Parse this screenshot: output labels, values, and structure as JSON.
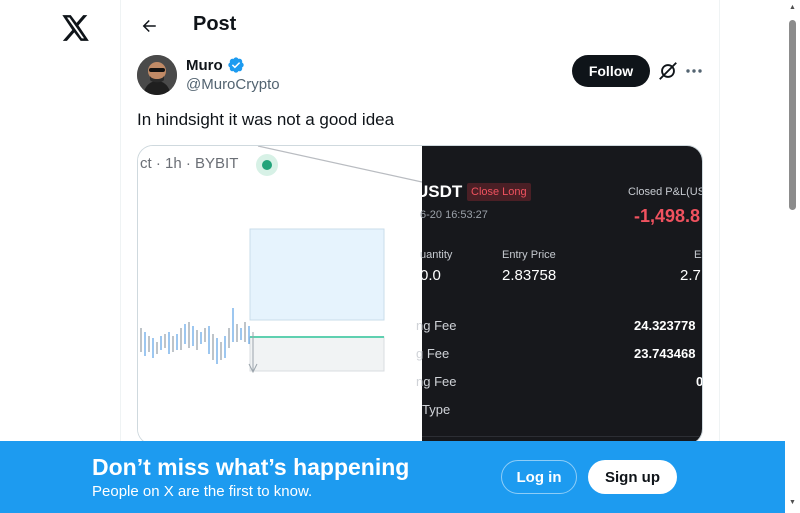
{
  "header": {
    "title": "Post"
  },
  "post": {
    "author_name": "Muro",
    "author_handle": "@MuroCrypto",
    "follow_label": "Follow",
    "text": "In hindsight it was not a good idea"
  },
  "media": {
    "chart_header": "ct · 1h · BYBIT",
    "trade": {
      "pair": "USDT",
      "badge": "Close Long",
      "date": "6-20 16:53:27",
      "pnl_label": "Closed P&L(US",
      "pnl_value": "-1,498.8",
      "quantity_label": "uantity",
      "quantity_value": "0.0",
      "entry_label": "Entry Price",
      "entry_value": "2.83758",
      "exit_label": "Ex",
      "exit_value": "2.7",
      "fees": [
        {
          "label": "ng Fee",
          "value": "24.323778"
        },
        {
          "label": "g Fee",
          "value": "23.743468"
        },
        {
          "label": "ng Fee",
          "value": "0"
        },
        {
          "label": "Type",
          "value": ""
        }
      ]
    },
    "colors": {
      "profit_loss": "#f0525f",
      "panel_dark": "#17181c",
      "accent_green": "#22a37a"
    }
  },
  "banner": {
    "title": "Don’t miss what’s happening",
    "subtitle": "People on X are the first to know.",
    "login_label": "Log in",
    "signup_label": "Sign up",
    "color": "#1d9bf0"
  },
  "icons": [
    "x-logo-icon",
    "back-arrow-icon",
    "verified-badge-icon",
    "grok-icon",
    "more-icon"
  ]
}
